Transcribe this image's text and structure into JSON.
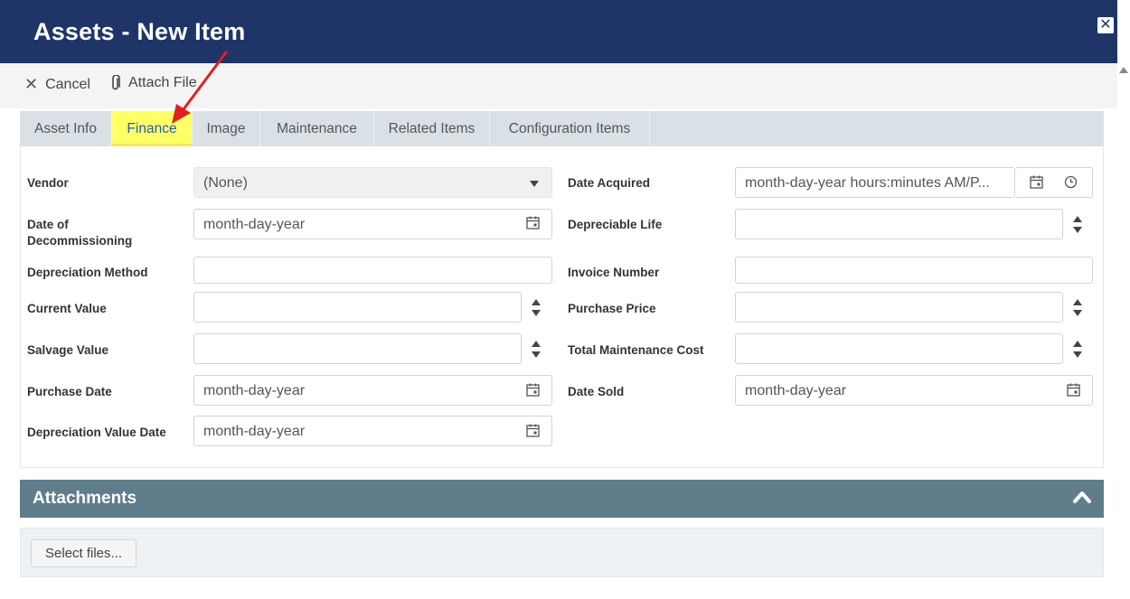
{
  "header": {
    "title": "Assets - New Item",
    "close_icon": "close-icon"
  },
  "toolbar": {
    "cancel_label": "Cancel",
    "attach_label": "Attach File"
  },
  "tabs": [
    {
      "label": "Asset Info",
      "active": false
    },
    {
      "label": "Finance",
      "active": true
    },
    {
      "label": "Image",
      "active": false
    },
    {
      "label": "Maintenance",
      "active": false
    },
    {
      "label": "Related Items",
      "active": false
    },
    {
      "label": "Configuration Items",
      "active": false
    }
  ],
  "form": {
    "left": [
      {
        "label": "Vendor",
        "value": "(None)",
        "kind": "select"
      },
      {
        "label_line1": "Date of",
        "label_line2": "Decommissioning",
        "placeholder": "month-day-year",
        "kind": "date"
      },
      {
        "label": "Depreciation Method",
        "value": "",
        "kind": "text"
      },
      {
        "label": "Current Value",
        "value": "",
        "kind": "number"
      },
      {
        "label": "Salvage Value",
        "value": "",
        "kind": "number"
      },
      {
        "label": "Purchase Date",
        "placeholder": "month-day-year",
        "kind": "date"
      },
      {
        "label": "Depreciation Value Date",
        "placeholder": "month-day-year",
        "kind": "date"
      }
    ],
    "right": [
      {
        "label": "Date Acquired",
        "placeholder": "month-day-year hours:minutes AM/P...",
        "kind": "datetime"
      },
      {
        "label": "Depreciable Life",
        "value": "",
        "kind": "number"
      },
      {
        "label": "Invoice Number",
        "value": "",
        "kind": "text"
      },
      {
        "label": "Purchase Price",
        "value": "",
        "kind": "number"
      },
      {
        "label": "Total Maintenance Cost",
        "value": "",
        "kind": "number"
      },
      {
        "label": "Date Sold",
        "placeholder": "month-day-year",
        "kind": "date"
      }
    ]
  },
  "attachments": {
    "title": "Attachments",
    "select_files_label": "Select files..."
  },
  "colors": {
    "header": "#1f3467",
    "active_tab_highlight": "#ffff66",
    "attachments_bar": "#5f7d8a",
    "annotation_arrow": "#e02020"
  }
}
